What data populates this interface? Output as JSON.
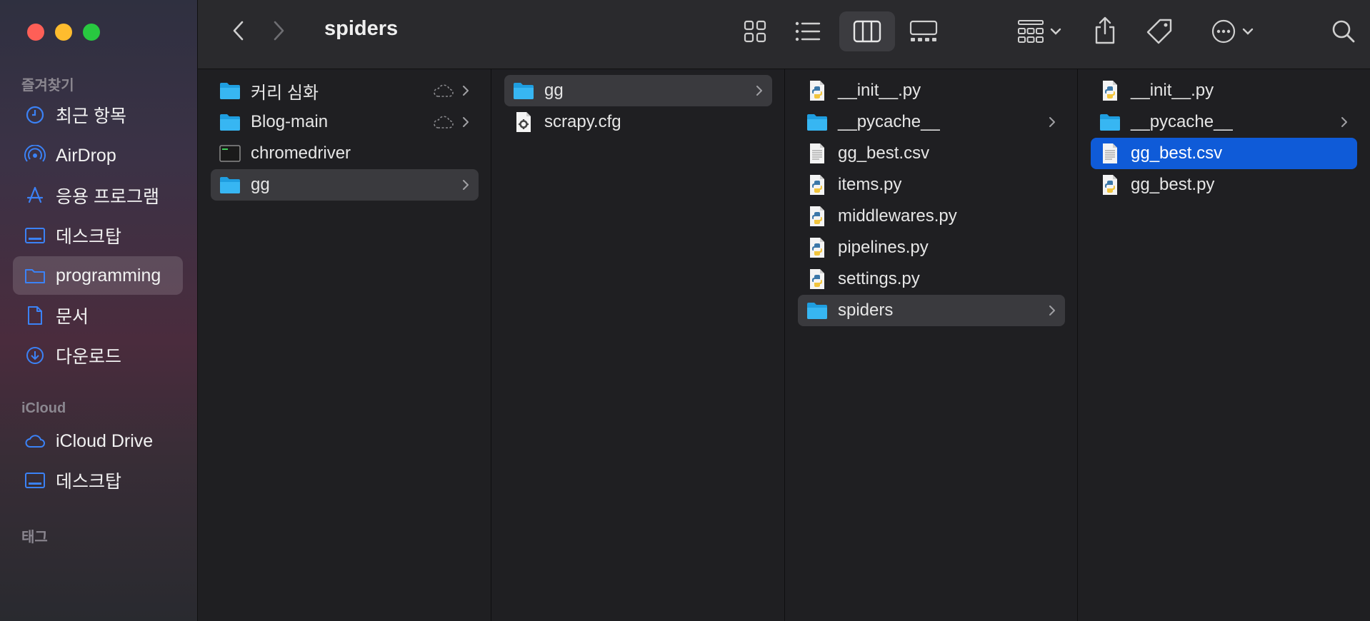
{
  "window": {
    "title": "spiders"
  },
  "sidebar": {
    "favorites_header": "즐겨찾기",
    "favorites": [
      {
        "label": "최근 항목",
        "icon": "clock-icon"
      },
      {
        "label": "AirDrop",
        "icon": "airdrop-icon"
      },
      {
        "label": "응용 프로그램",
        "icon": "applications-icon"
      },
      {
        "label": "데스크탑",
        "icon": "desktop-icon"
      },
      {
        "label": "programming",
        "icon": "folder-icon",
        "selected": true
      },
      {
        "label": "문서",
        "icon": "document-icon"
      },
      {
        "label": "다운로드",
        "icon": "download-icon"
      }
    ],
    "icloud_header": "iCloud",
    "icloud": [
      {
        "label": "iCloud Drive",
        "icon": "cloud-icon"
      },
      {
        "label": "데스크탑",
        "icon": "desktop-icon"
      }
    ],
    "tags_header": "태그"
  },
  "toolbar": {
    "icons": [
      "back-icon",
      "forward-icon",
      "icon-view-icon",
      "list-view-icon",
      "column-view-icon",
      "gallery-view-icon",
      "group-icon",
      "share-icon",
      "tag-icon",
      "more-icon",
      "search-icon"
    ]
  },
  "columns": [
    {
      "items": [
        {
          "name": "커리 심화",
          "type": "folder",
          "cloud": true,
          "chevron": true
        },
        {
          "name": "Blog-main",
          "type": "folder",
          "cloud": true,
          "chevron": true
        },
        {
          "name": "chromedriver",
          "type": "exec"
        },
        {
          "name": "gg",
          "type": "folder",
          "chevron": true,
          "highlight": true
        }
      ]
    },
    {
      "items": [
        {
          "name": "gg",
          "type": "folder",
          "chevron": true,
          "highlight": true
        },
        {
          "name": "scrapy.cfg",
          "type": "cfg"
        }
      ]
    },
    {
      "items": [
        {
          "name": "__init__.py",
          "type": "py"
        },
        {
          "name": "__pycache__",
          "type": "folder",
          "chevron": true
        },
        {
          "name": "gg_best.csv",
          "type": "doc"
        },
        {
          "name": "items.py",
          "type": "py"
        },
        {
          "name": "middlewares.py",
          "type": "py"
        },
        {
          "name": "pipelines.py",
          "type": "py"
        },
        {
          "name": "settings.py",
          "type": "py"
        },
        {
          "name": "spiders",
          "type": "folder",
          "chevron": true,
          "highlight": true
        }
      ]
    },
    {
      "items": [
        {
          "name": "__init__.py",
          "type": "py"
        },
        {
          "name": "__pycache__",
          "type": "folder",
          "chevron": true
        },
        {
          "name": "gg_best.csv",
          "type": "doc",
          "selected": true
        },
        {
          "name": "gg_best.py",
          "type": "py"
        }
      ]
    }
  ]
}
